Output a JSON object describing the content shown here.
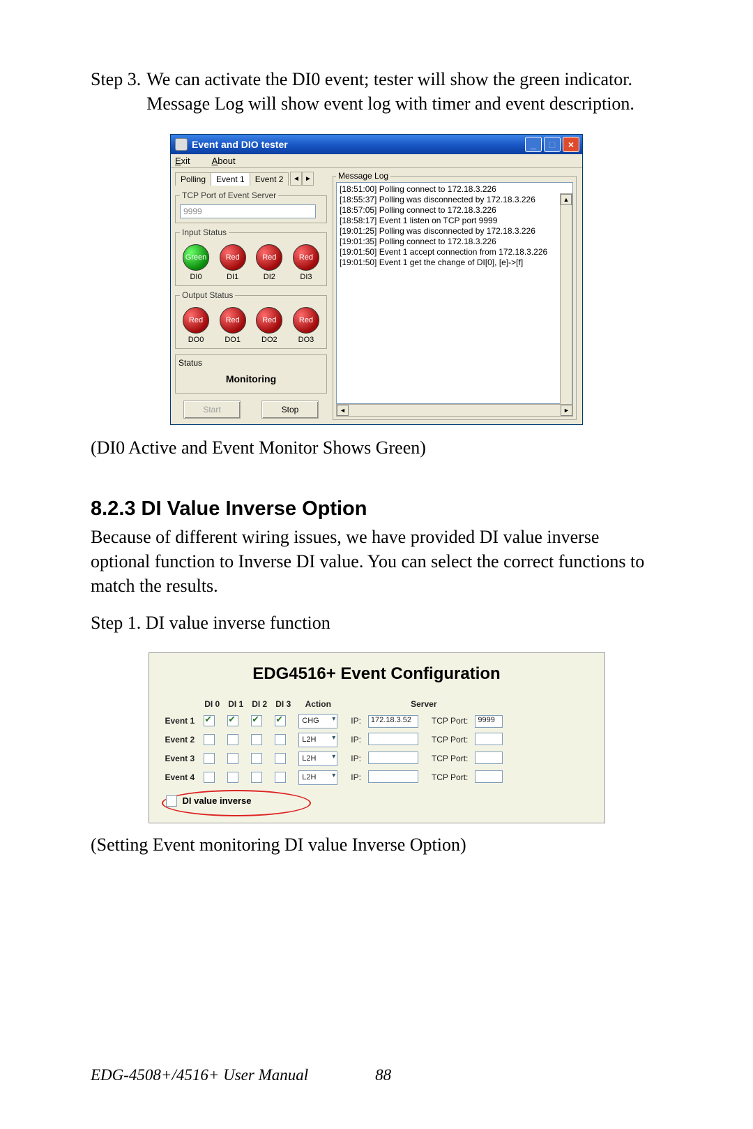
{
  "step3": {
    "label": "Step 3.",
    "text": "We can activate the DI0 event; tester will show the green indicator. Message Log will show event log with timer and event description."
  },
  "window": {
    "title": "Event and DIO tester",
    "menu_exit": "Exit",
    "menu_about": "About",
    "tabs": {
      "polling": "Polling",
      "event1": "Event 1",
      "event2": "Event 2"
    },
    "tcp_legend": "TCP Port of Event Server",
    "tcp_value": "9999",
    "input_legend": "Input Status",
    "inputs": [
      {
        "label": "DI0",
        "color": "green",
        "text": "Green"
      },
      {
        "label": "DI1",
        "color": "red",
        "text": "Red"
      },
      {
        "label": "DI2",
        "color": "red",
        "text": "Red"
      },
      {
        "label": "DI3",
        "color": "red",
        "text": "Red"
      }
    ],
    "output_legend": "Output Status",
    "outputs": [
      {
        "label": "DO0",
        "color": "red",
        "text": "Red"
      },
      {
        "label": "DO1",
        "color": "red",
        "text": "Red"
      },
      {
        "label": "DO2",
        "color": "red",
        "text": "Red"
      },
      {
        "label": "DO3",
        "color": "red",
        "text": "Red"
      }
    ],
    "status_legend": "Status",
    "status_text": "Monitoring",
    "start_label": "Start",
    "stop_label": "Stop",
    "msglog_legend": "Message Log",
    "log": [
      "[18:51:00] Polling connect to 172.18.3.226",
      "[18:55:37] Polling was disconnected by 172.18.3.226",
      "[18:57:05] Polling connect to 172.18.3.226",
      "[18:58:17] Event 1 listen on TCP port 9999",
      "[19:01:25] Polling was disconnected by 172.18.3.226",
      "[19:01:35] Polling connect to 172.18.3.226",
      "[19:01:50] Event 1 accept connection from 172.18.3.226",
      "[19:01:50] Event 1 get the change of DI[0], [e]->[f]"
    ]
  },
  "caption1": "(DI0 Active and Event Monitor Shows Green)",
  "section": {
    "heading": "8.2.3 DI Value Inverse Option",
    "para": "Because of different wiring issues, we have provided DI value inverse optional function to Inverse DI value. You can select the correct functions to match the results.",
    "step1": "Step 1. DI value inverse function"
  },
  "cfg": {
    "title": "EDG4516+ Event Configuration",
    "headers": {
      "di0": "DI 0",
      "di1": "DI 1",
      "di2": "DI 2",
      "di3": "DI 3",
      "action": "Action",
      "server": "Server",
      "ip": "IP:",
      "tcpport": "TCP Port:"
    },
    "rows": [
      {
        "name": "Event 1",
        "di": [
          true,
          true,
          true,
          true
        ],
        "action": "CHG",
        "ip": "172.18.3.52",
        "port": "9999"
      },
      {
        "name": "Event 2",
        "di": [
          false,
          false,
          false,
          false
        ],
        "action": "L2H",
        "ip": "",
        "port": ""
      },
      {
        "name": "Event 3",
        "di": [
          false,
          false,
          false,
          false
        ],
        "action": "L2H",
        "ip": "",
        "port": ""
      },
      {
        "name": "Event 4",
        "di": [
          false,
          false,
          false,
          false
        ],
        "action": "L2H",
        "ip": "",
        "port": ""
      }
    ],
    "di_inverse_label": "DI value inverse"
  },
  "caption2": "(Setting Event monitoring DI value Inverse Option)",
  "footer": {
    "manual": "EDG-4508+/4516+ User Manual",
    "page": "88"
  }
}
